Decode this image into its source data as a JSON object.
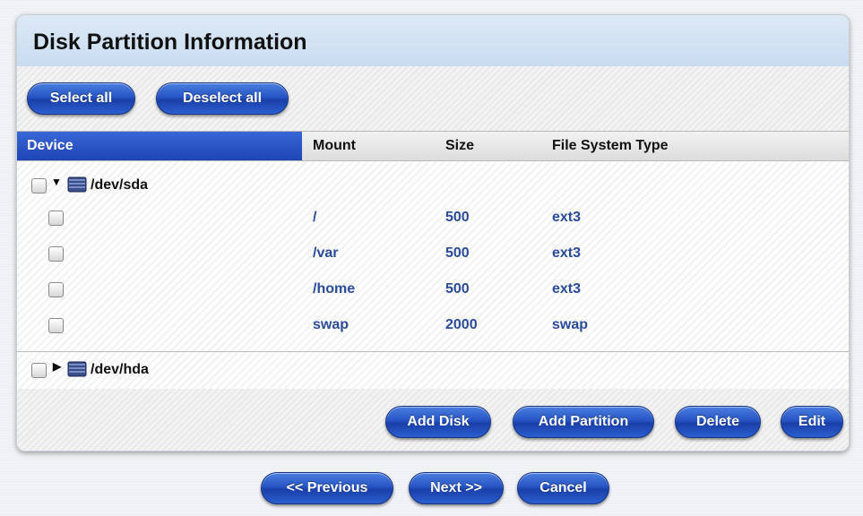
{
  "title": "Disk Partition Information",
  "toolbar": {
    "select_all": "Select all",
    "deselect_all": "Deselect all"
  },
  "columns": {
    "device": "Device",
    "mount": "Mount",
    "size": "Size",
    "fs_type": "File System Type"
  },
  "disks": [
    {
      "name": "/dev/sda",
      "expanded": true,
      "partitions": [
        {
          "mount": "/",
          "size": "500",
          "fs": "ext3"
        },
        {
          "mount": "/var",
          "size": "500",
          "fs": "ext3"
        },
        {
          "mount": "/home",
          "size": "500",
          "fs": "ext3"
        },
        {
          "mount": "swap",
          "size": "2000",
          "fs": "swap"
        }
      ]
    },
    {
      "name": "/dev/hda",
      "expanded": false,
      "partitions": []
    }
  ],
  "actions": {
    "add_disk": "Add Disk",
    "add_partition": "Add Partition",
    "delete": "Delete",
    "edit": "Edit"
  },
  "nav": {
    "previous": "<< Previous",
    "next": "Next >>",
    "cancel": "Cancel"
  },
  "colors": {
    "button_blue": "#2754c4",
    "header_blue": "#1e45b3",
    "cell_text": "#2a4a9a"
  },
  "icons": {
    "expanded": "triangle-down-icon",
    "collapsed": "triangle-right-icon",
    "disk": "disk-drive-icon"
  }
}
